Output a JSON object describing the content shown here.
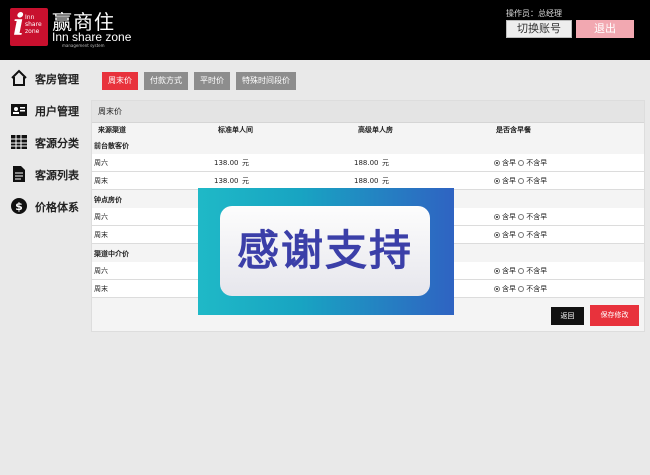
{
  "header": {
    "logo_small": "Inn share zone",
    "logo_cn": "赢商住",
    "logo_en": "Inn share zone",
    "logo_sub": "management system",
    "operator_label": "操作员：总经理",
    "switch_account": "切换账号",
    "logout": "退出"
  },
  "sidebar": {
    "items": [
      {
        "label": "客房管理",
        "icon": "home-icon"
      },
      {
        "label": "用户管理",
        "icon": "id-card-icon"
      },
      {
        "label": "客源分类",
        "icon": "grid-icon"
      },
      {
        "label": "客源列表",
        "icon": "document-icon"
      },
      {
        "label": "价格体系",
        "icon": "dollar-icon"
      }
    ]
  },
  "tabs": [
    {
      "label": "周末价",
      "active": true
    },
    {
      "label": "付款方式",
      "active": false
    },
    {
      "label": "平时价",
      "active": false
    },
    {
      "label": "特殊时间段价",
      "active": false
    }
  ],
  "panel": {
    "title": "周末价",
    "columns": [
      "来源渠道",
      "标准单人间",
      "高级单人房",
      "是否含早餐"
    ],
    "groups": [
      {
        "name": "前台散客价",
        "rows": [
          {
            "day": "周六",
            "std": "138.00",
            "adv": "188.00",
            "unit": "元"
          },
          {
            "day": "周末",
            "std": "138.00",
            "adv": "188.00",
            "unit": "元"
          }
        ]
      },
      {
        "name": "钟点房价",
        "rows": [
          {
            "day": "周六"
          },
          {
            "day": "周末"
          }
        ]
      },
      {
        "name": "渠道中介价",
        "rows": [
          {
            "day": "周六"
          },
          {
            "day": "周末"
          }
        ]
      }
    ],
    "breakfast_yes": "含早",
    "breakfast_no": "不含早"
  },
  "actions": {
    "back": "返回",
    "save": "保存修改"
  },
  "banner": {
    "text": "感谢支持"
  },
  "colors": {
    "header_bg": "#000000",
    "accent_red": "#e8323c",
    "tab_inactive": "#8d8d8d"
  }
}
